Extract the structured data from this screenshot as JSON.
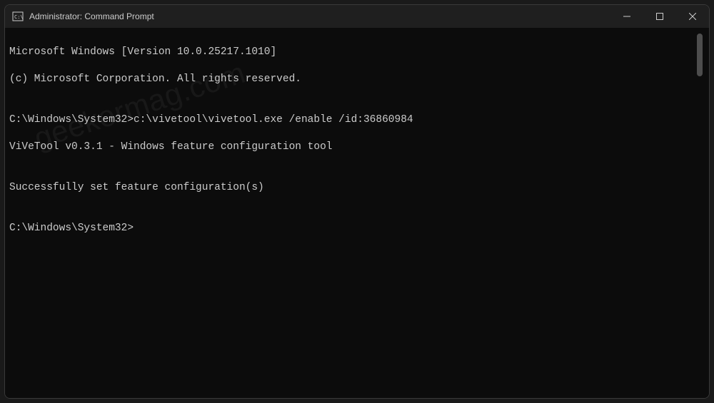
{
  "window": {
    "title": "Administrator: Command Prompt"
  },
  "console": {
    "lines": [
      "Microsoft Windows [Version 10.0.25217.1010]",
      "(c) Microsoft Corporation. All rights reserved.",
      "",
      "C:\\Windows\\System32>c:\\vivetool\\vivetool.exe /enable /id:36860984",
      "ViVeTool v0.3.1 - Windows feature configuration tool",
      "",
      "Successfully set feature configuration(s)",
      "",
      "C:\\Windows\\System32>"
    ]
  },
  "watermark": "geekermag.com"
}
